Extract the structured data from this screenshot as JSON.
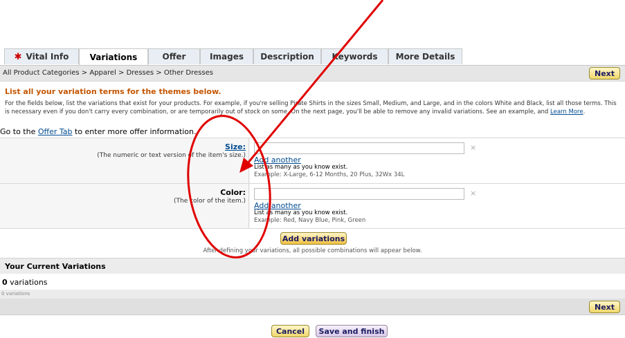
{
  "tabs": [
    {
      "label": "Vital Info",
      "required": true
    },
    {
      "label": "Variations",
      "active": true
    },
    {
      "label": "Offer"
    },
    {
      "label": "Images"
    },
    {
      "label": "Description"
    },
    {
      "label": "Keywords"
    },
    {
      "label": "More Details"
    }
  ],
  "breadcrumb": "All Product Categories > Apparel > Dresses > Other Dresses",
  "next_label": "Next",
  "heading": "List all your variation terms for the themes below.",
  "description": "For the fields below, list the variations that exist for your products. For example, if you're selling Pirate Shirts in the sizes Small, Medium, and Large, and in the colors White and Black, list all those terms. This is necessary even if you don't carry every combination, or are temporarily out of stock on some. On the next page, you'll be able to remove any invalid variations. See an example, and",
  "learn_more": "Learn More",
  "learn_more_suffix": ".",
  "offer_line_pre": "Go to the",
  "offer_tab_link": "Offer Tab",
  "offer_line_post": "to enter more offer information.",
  "size": {
    "label": "Size:",
    "sub": "(The numeric or text version of the item's size.)",
    "add_another": "Add another",
    "hint": "List as many as you know exist.",
    "example": "Example: X-Large, 6-12 Months, 20 Plus, 32Wx 34L"
  },
  "color": {
    "label": "Color:",
    "sub": "(The color of the item.)",
    "add_another": "Add another",
    "hint": "List as many as you know exist.",
    "example": "Example: Red, Navy Blue, Pink, Green"
  },
  "remove_symbol": "×",
  "add_variations_label": "Add variations",
  "after_note": "After defining your variations, all possible combinations will appear below.",
  "current_variations_title": "Your Current Variations",
  "variation_count": "0",
  "variation_count_suffix": "variations",
  "variation_small": "0 variations",
  "cancel_label": "Cancel",
  "save_label": "Save and finish",
  "colors": {
    "annotation_red": "#e00000",
    "heading_orange": "#c45500",
    "link_blue": "#004b91"
  }
}
